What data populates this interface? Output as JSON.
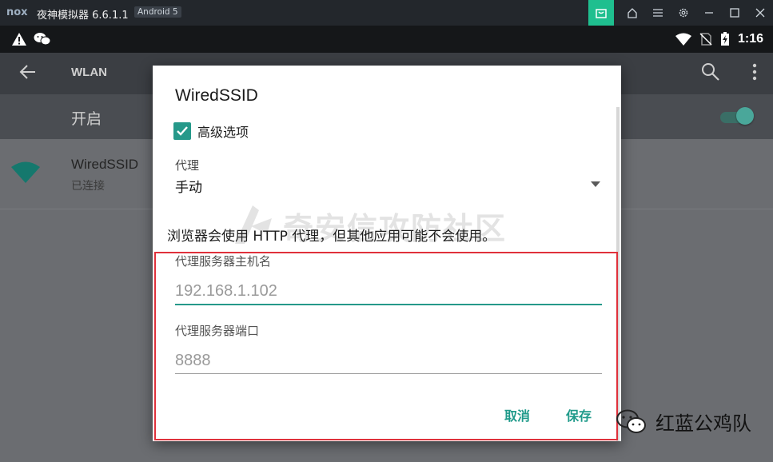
{
  "titlebar": {
    "logo": "nox",
    "title": "夜神模拟器 6.6.1.1",
    "android_badge": "Android 5",
    "buttons": [
      "store-icon",
      "home-icon",
      "menu-icon",
      "gear-icon",
      "minimize-icon",
      "maximize-icon",
      "close-icon"
    ]
  },
  "statusbar": {
    "time": "1:16"
  },
  "appbar": {
    "title": "WLAN"
  },
  "switch_row": {
    "label": "开启",
    "on": true
  },
  "network": {
    "name": "WiredSSID",
    "status": "已连接"
  },
  "dialog": {
    "title": "WiredSSID",
    "advanced_label": "高级选项",
    "advanced_checked": true,
    "proxy_label": "代理",
    "proxy_value": "手动",
    "note": "浏览器会使用 HTTP 代理，但其他应用可能不会使用。",
    "host_label": "代理服务器主机名",
    "host_value": "192.168.1.102",
    "port_label": "代理服务器端口",
    "port_value": "8888",
    "cancel_label": "取消",
    "save_label": "保存"
  },
  "watermark_text": "奇安信攻防社区",
  "wechat_account": "红蓝公鸡队",
  "colors": {
    "accent": "#26998a",
    "highlight": "#e0313b",
    "switch_thumb": "#4aa79a"
  }
}
